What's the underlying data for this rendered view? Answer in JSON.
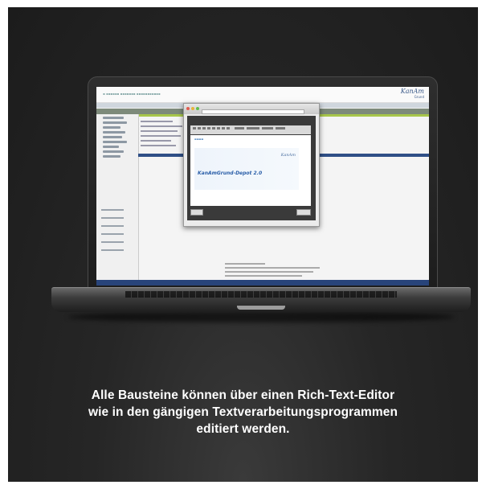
{
  "caption": {
    "line1": "Alle Bausteine können über einen Rich-Text-Editor",
    "line2": "wie in den gängigen Textverarbeitungsprogrammen",
    "line3": "editiert werden."
  },
  "screen": {
    "brand": {
      "name": "KanAm",
      "sub": "Grund"
    },
    "editor": {
      "banner_text": "KanAmGrund-Depot 2.0",
      "banner_logo": "KanAm"
    }
  },
  "colors": {
    "background": "#262626",
    "nav_blue": "#2f4f86",
    "accent_green": "#a7c64a",
    "caption_text": "#ffffff"
  }
}
